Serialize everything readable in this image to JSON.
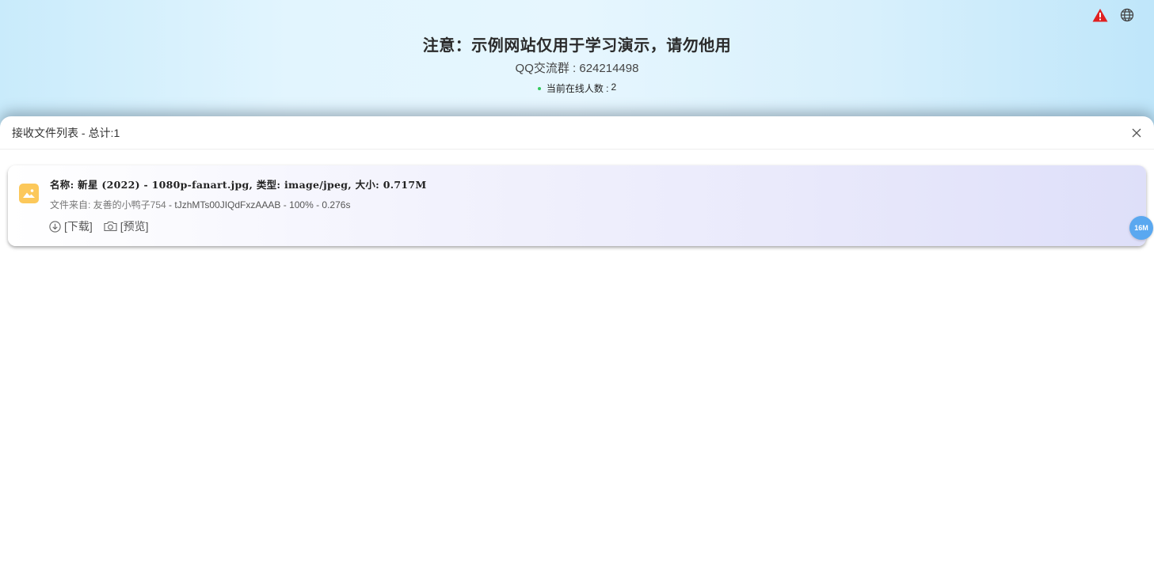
{
  "header": {
    "notice": "注意：示例网站仅用于学习演示，请勿他用",
    "qq_group": "QQ交流群 : 624214498",
    "online_label": "当前在线人数 :",
    "online_count": "2"
  },
  "top_icons": [
    {
      "name": "warning-icon",
      "color": "#e02020"
    },
    {
      "name": "globe-icon",
      "color": "#444444"
    }
  ],
  "drawer": {
    "title": "接收文件列表 -",
    "total": "总计:1"
  },
  "files": [
    {
      "name_line": "名称: 新星 (2022) - 1080p-fanart.jpg, 类型: image/jpeg, 大小: 0.717M",
      "from_prefix": "文件来自: 友善的小鸭子754",
      "from_detail": " - tJzhMTs00JIQdFxzAAAB - 100% - 0.276s",
      "download_label": "[下载]",
      "preview_label": "[预览]",
      "icon": "image-file-icon",
      "icon_color": "#fcc85a"
    }
  ],
  "badge": {
    "label": "16M",
    "color": "#5aa8f0"
  }
}
